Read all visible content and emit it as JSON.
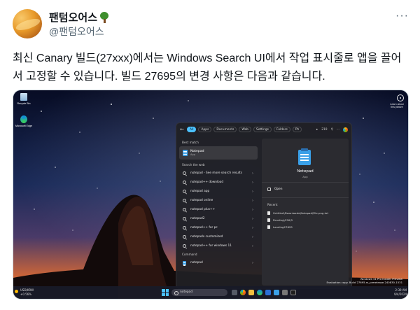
{
  "author": {
    "name": "팬텀오어스",
    "handle": "@팬텀오어스"
  },
  "post": {
    "text": "최신 Canary 빌드(27xxx)에서는 Windows Search UI에서 작업 표시줄로 앱을 끌어서 고정할 수 있습니다. 빌드 27695의 변경 사항은 다음과 같습니다.",
    "more_label": "···"
  },
  "screenshot": {
    "desktop_icons": [
      {
        "label": "Recycle Bin",
        "icon": "recycle-bin-icon"
      },
      {
        "label": "Microsoft Edge",
        "icon": "edge-icon"
      }
    ],
    "top_right_label": "Learn about this picture",
    "filters": {
      "back": "←",
      "chips": [
        "All",
        "Apps",
        "Documents",
        "Web",
        "Settings",
        "Folders",
        "Ph"
      ],
      "active": "All",
      "right": [
        "▸",
        "219",
        "⚲",
        "···"
      ]
    },
    "best_match_label": "Best match",
    "best_match": {
      "title": "Notepad",
      "subtitle": "App"
    },
    "search_web_label": "Search the web",
    "web_results": [
      "notepad - See more search results",
      "notepad++ download",
      "notepad app",
      "notepad online",
      "notepad plus++",
      "notepad2",
      "notepad++ for pc",
      "notepadx customized",
      "notepad++ for windows 11"
    ],
    "command_label": "Command",
    "command_item": "notepad",
    "detail": {
      "title": "Notepad",
      "subtitle": "App",
      "open_label": "Open",
      "recent_label": "Recent",
      "recent_items": [
        "Untitled\\Downloads\\Notepad\\File.png.txt",
        "Pending\\250\\5",
        "Landing27695"
      ]
    },
    "taskbar": {
      "weather_temp": "USD/KRW",
      "weather_sub": "+0.56%",
      "search_text": "notepad",
      "clock_time": "2:39 AM",
      "clock_date": "9/4/2024"
    },
    "watermark": [
      "Windows 11 Pro Insider Preview",
      "Evaluation copy. Build 27695.rs_prerelease.240830-1531"
    ],
    "colors": {
      "accent": "#4cc2ff",
      "panel": "#202024",
      "detail": "#2b2b30"
    }
  }
}
